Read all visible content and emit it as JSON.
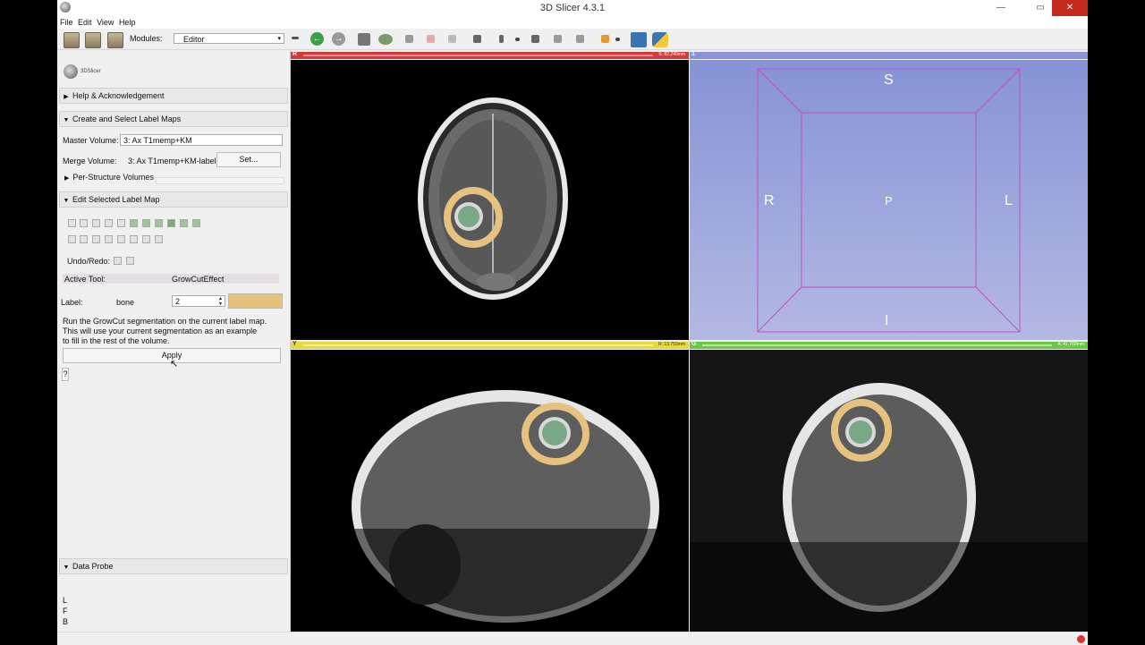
{
  "window": {
    "title": "3D Slicer 4.3.1",
    "minimize": "—",
    "maximize": "▭",
    "close": "✕"
  },
  "menu": [
    "File",
    "Edit",
    "View",
    "Help"
  ],
  "toolbar": {
    "modules_label": "Modules:",
    "module_value": "Editor",
    "load_data": "DATA",
    "load_dicom": "DCM",
    "save": "SAVE"
  },
  "panel": {
    "logo_text": "3DSlicer",
    "help_section": "Help & Acknowledgement",
    "create_section": "Create and Select Label Maps",
    "master_label": "Master Volume:",
    "master_value": "3: Ax T1memp+KM",
    "merge_label": "Merge Volume:",
    "merge_value": "3: Ax T1memp+KM-label",
    "set_button": "Set...",
    "per_structure": "Per-Structure Volumes",
    "edit_section": "Edit Selected Label Map",
    "undo_redo": "Undo/Redo:",
    "active_tool_label": "Active Tool:",
    "active_tool_value": "GrowCutEffect",
    "label_label": "Label:",
    "label_name": "bone",
    "label_value": "2",
    "label_color": "#e7c27f",
    "desc1": "Run the GrowCut segmentation on the current label map.",
    "desc2": "This will use your current segmentation as an example",
    "desc3": "to fill in the rest of the volume.",
    "apply_button": "Apply",
    "help_q": "?",
    "data_probe": "Data Probe",
    "probe_l": "L",
    "probe_f": "F",
    "probe_b": "B"
  },
  "views": {
    "red": {
      "letter": "R",
      "offset": "S: 82.240mm",
      "color": "#e55a5a"
    },
    "threed": {
      "letter": "1",
      "S": "S",
      "R": "R",
      "P": "P",
      "L": "L",
      "I": "I"
    },
    "yellow": {
      "letter": "Y",
      "offset": "R: 13.750mm",
      "color": "#e6d93c"
    },
    "green": {
      "letter": "G",
      "offset": "A: 41.760mm",
      "color": "#6cc64a"
    }
  }
}
